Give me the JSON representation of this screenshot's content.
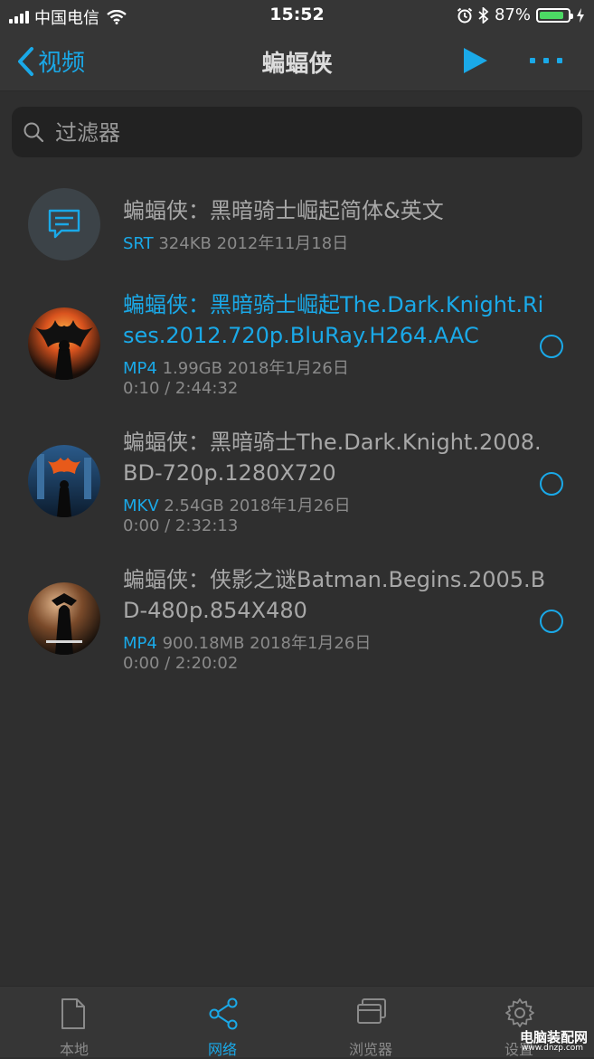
{
  "status_bar": {
    "carrier": "中国电信",
    "time": "15:52",
    "battery": "87%",
    "battery_level": 0.87
  },
  "nav": {
    "back_label": "视频",
    "title": "蝙蝠侠"
  },
  "search": {
    "placeholder": "过滤器"
  },
  "items": [
    {
      "title": "蝙蝠侠：黑暗骑士崛起简体&英文",
      "format": "SRT",
      "info": " 324KB 2012年11月18日",
      "progress": "",
      "icon": "subtitle-icon",
      "active": false
    },
    {
      "title": "蝙蝠侠：黑暗骑士崛起The.Dark.Knight.Rises.2012.720p.BluRay.H264.AAC",
      "format": "MP4",
      "info": " 1.99GB 2018年1月26日",
      "progress": "0:10 / 2:44:32",
      "active": true
    },
    {
      "title": "蝙蝠侠：黑暗骑士The.Dark.Knight.2008.BD-720p.1280X720",
      "format": "MKV",
      "info": " 2.54GB 2018年1月26日",
      "progress": "0:00 / 2:32:13",
      "active": false
    },
    {
      "title": "蝙蝠侠：侠影之谜Batman.Begins.2005.BD-480p.854X480",
      "format": "MP4",
      "info": " 900.18MB 2018年1月26日",
      "progress": "0:00 / 2:20:02",
      "active": false
    }
  ],
  "tabs": [
    {
      "label": "本地",
      "icon": "document-icon",
      "active": false
    },
    {
      "label": "网络",
      "icon": "share-icon",
      "active": true
    },
    {
      "label": "浏览器",
      "icon": "browser-icon",
      "active": false
    },
    {
      "label": "设置",
      "icon": "gear-icon",
      "active": false
    }
  ],
  "watermark": {
    "text": "电脑装配网",
    "url": "www.dnzp.com"
  },
  "colors": {
    "accent": "#1aa9e8",
    "background": "#2f2f2f",
    "bar": "#363636"
  }
}
